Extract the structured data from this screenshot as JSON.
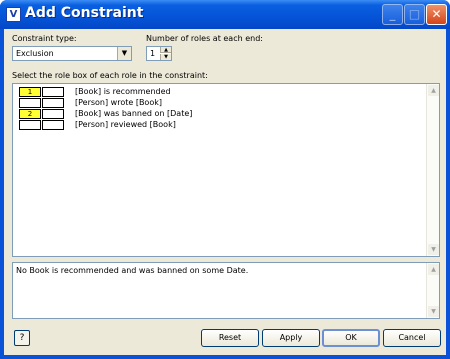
{
  "window": {
    "title": "Add Constraint",
    "icon_letter": "V",
    "minimize_glyph": "_",
    "maximize_glyph": "□",
    "close_glyph": "✕"
  },
  "constraint_type": {
    "label": "Constraint type:",
    "value": "Exclusion",
    "arrow": "▼"
  },
  "roles_per_end": {
    "label": "Number of roles at each end:",
    "value": "1",
    "up": "▲",
    "down": "▼"
  },
  "list_label": "Select the role box of each role in the constraint:",
  "fact_types": [
    {
      "box1": "1",
      "box1_selected": true,
      "box2": "",
      "box2_selected": false,
      "text": "[Book] is recommended"
    },
    {
      "box1": "",
      "box1_selected": false,
      "box2": "",
      "box2_selected": false,
      "text": "[Person] wrote [Book]"
    },
    {
      "box1": "2",
      "box1_selected": true,
      "box2": "",
      "box2_selected": false,
      "text": "[Book] was banned on [Date]"
    },
    {
      "box1": "",
      "box1_selected": false,
      "box2": "",
      "box2_selected": false,
      "text": "[Person] reviewed [Book]"
    }
  ],
  "scroll": {
    "up": "▲",
    "down": "▼"
  },
  "verbalization": "No Book is recommended and was banned on some Date.",
  "buttons": {
    "help": "?",
    "reset": "Reset",
    "apply": "Apply",
    "ok": "OK",
    "cancel": "Cancel"
  },
  "colors": {
    "title_bar": "#0553d8",
    "selected_role": "#ffff33",
    "dialog_bg": "#ece9d8"
  }
}
